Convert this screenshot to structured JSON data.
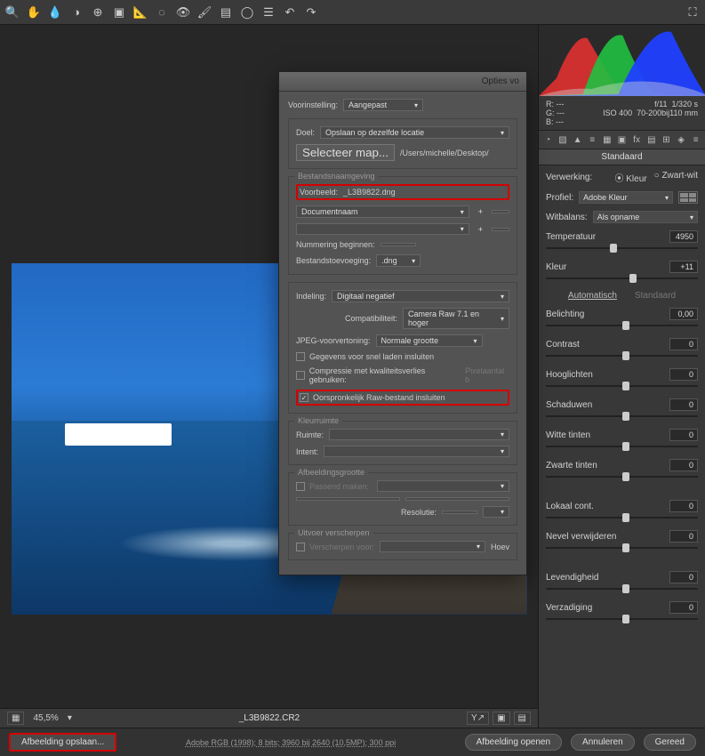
{
  "toolbar_icons": [
    "zoom",
    "hand",
    "eyedropper",
    "sampler",
    "targeted",
    "crop",
    "straighten",
    "spot",
    "brush",
    "redeye",
    "grad",
    "radial",
    "prefs",
    "rotate-ccw",
    "rotate-cw"
  ],
  "toolbar_right_icon": "fullscreen",
  "info": {
    "R": "R:    ---",
    "G": "G:    ---",
    "B": "B:    ---",
    "aperture": "f/11",
    "shutter": "1/320 s",
    "iso": "ISO 400",
    "lens": "70-200bij110 mm"
  },
  "panel": {
    "tabs_title": "Standaard",
    "verwerking": "Verwerking:",
    "kleur": "Kleur",
    "zwartwit": "Zwart-wit",
    "profiel": "Profiel:",
    "profiel_value": "Adobe Kleur",
    "witbalans": "Witbalans:",
    "witbalans_value": "Als opname",
    "sliders": {
      "temperatuur": {
        "label": "Temperatuur",
        "value": "4950",
        "pos": 42
      },
      "kleur": {
        "label": "Kleur",
        "value": "+11",
        "pos": 55
      },
      "auto": "Automatisch",
      "standaard": "Standaard",
      "belichting": {
        "label": "Belichting",
        "value": "0,00",
        "pos": 50
      },
      "contrast": {
        "label": "Contrast",
        "value": "0",
        "pos": 50
      },
      "hooglichten": {
        "label": "Hooglichten",
        "value": "0",
        "pos": 50
      },
      "schaduwen": {
        "label": "Schaduwen",
        "value": "0",
        "pos": 50
      },
      "wittetinten": {
        "label": "Witte tinten",
        "value": "0",
        "pos": 50
      },
      "zwartetinten": {
        "label": "Zwarte tinten",
        "value": "0",
        "pos": 50
      },
      "lokaalcont": {
        "label": "Lokaal cont.",
        "value": "0",
        "pos": 50
      },
      "nevel": {
        "label": "Nevel verwijderen",
        "value": "0",
        "pos": 50
      },
      "levendigheid": {
        "label": "Levendigheid",
        "value": "0",
        "pos": 50
      },
      "verzadiging": {
        "label": "Verzadiging",
        "value": "0",
        "pos": 50
      }
    }
  },
  "statusbar": {
    "zoom": "45,5%",
    "filename": "_L3B9822.CR2",
    "ruler_icon": "Y↗"
  },
  "bottombar": {
    "save": "Afbeelding opslaan...",
    "metadata": "Adobe RGB (1998); 8 bits; 3960 bij 2640 (10,5MP); 300 ppi",
    "open": "Afbeelding openen",
    "cancel": "Annuleren",
    "done": "Gereed"
  },
  "dialog": {
    "title": "Opties vo",
    "voorinstelling": "Voorinstelling:",
    "voorinstelling_value": "Aangepast",
    "doel": "Doel:",
    "doel_value": "Opslaan op dezelfde locatie",
    "selecteer_map": "Selecteer map...",
    "pad": "/Users/michelle/Desktop/",
    "naamgeving": "Bestandsnaamgeving",
    "voorbeeld": "Voorbeeld:",
    "voorbeeld_value": "_L3B9822.dng",
    "documentnaam": "Documentnaam",
    "nummering": "Nummering beginnen:",
    "extensie": "Bestandstoevoeging:",
    "extensie_value": ".dng",
    "indeling": "Indeling:",
    "indeling_value": "Digitaal negatief",
    "compat": "Compatibiliteit:",
    "compat_value": "Camera Raw 7.1 en hoger",
    "jpegpv": "JPEG-voorvertoning:",
    "jpegpv_value": "Normale grootte",
    "fastload": "Gegevens voor snel laden insluiten",
    "lossy": "Compressie met kwaliteitsverlies gebruiken:",
    "pixelcount": "Pixelaantal b",
    "embedraw": "Oorspronkelijk Raw-bestand insluiten",
    "kleurruimte": "Kleurruimte",
    "ruimte": "Ruimte:",
    "intent": "Intent:",
    "afbeeldingsgrootte": "Afbeeldingsgrootte",
    "passend": "Passend maken:",
    "resolutie": "Resolutie:",
    "uitvoer": "Uitvoer verscherpen",
    "verscherpen": "Verscherpen voor:",
    "hoeveel": "Hoev"
  }
}
